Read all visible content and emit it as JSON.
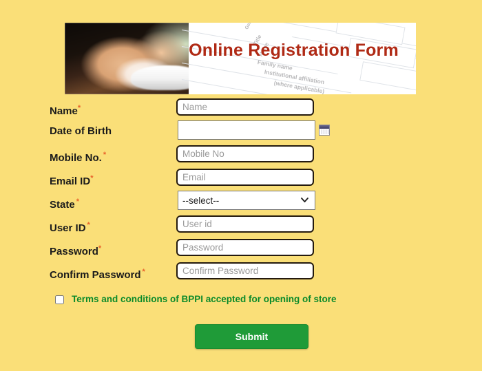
{
  "page": {
    "background_color": "#fadf78"
  },
  "banner": {
    "title": "Online Registration Form",
    "title_color": "#b02a15",
    "background_words": [
      "Gender",
      "Title",
      "Name",
      "Family name",
      "Institutional affiliation",
      "(where applicable)"
    ]
  },
  "form": {
    "fields": [
      {
        "label": "Name",
        "required": true,
        "placeholder": "Name",
        "value": "",
        "type": "text"
      },
      {
        "label": "Date of Birth",
        "required": false,
        "placeholder": "",
        "value": "",
        "type": "date"
      },
      {
        "label": "Mobile No.",
        "required": true,
        "placeholder": "Mobile No",
        "value": "",
        "type": "text"
      },
      {
        "label": "Email ID",
        "required": true,
        "placeholder": "Email",
        "value": "",
        "type": "text"
      },
      {
        "label": "State",
        "required": true,
        "placeholder": "",
        "value": "--select--",
        "type": "select"
      },
      {
        "label": "User ID",
        "required": true,
        "placeholder": "User id",
        "value": "",
        "type": "text"
      },
      {
        "label": "Password",
        "required": true,
        "placeholder": "Password",
        "value": "",
        "type": "password"
      },
      {
        "label": "Confirm Password",
        "required": true,
        "placeholder": "Confirm Password",
        "value": "",
        "type": "password"
      }
    ],
    "required_marker": "*",
    "required_marker_color": "#e8622a",
    "state_options": [
      "--select--"
    ]
  },
  "terms": {
    "checked": false,
    "text": "Terms and conditions of BPPI accepted for opening of store",
    "text_color": "#0a8a2a"
  },
  "submit": {
    "label": "Submit",
    "color": "#1f9b38"
  }
}
